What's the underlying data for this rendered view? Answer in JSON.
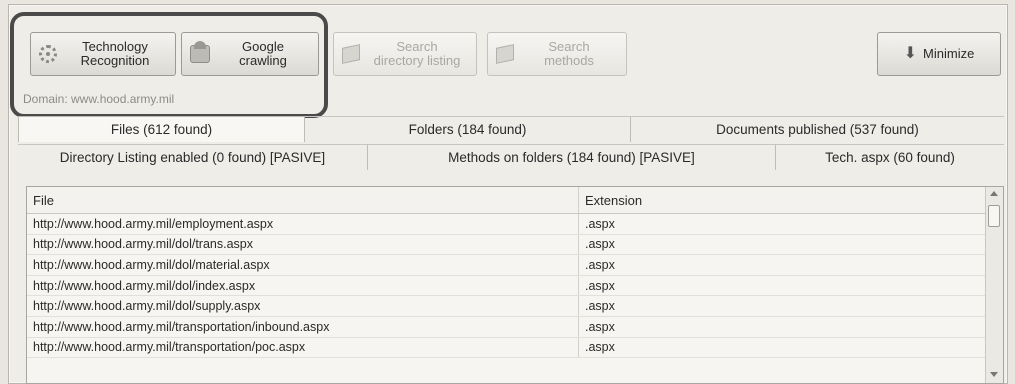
{
  "toolbar": {
    "technology_recognition": "Technology\nRecognition",
    "google_crawling": "Google\ncrawling",
    "search_directory_listing": "Search\ndirectory listing",
    "search_methods": "Search\nmethods",
    "minimize": "Minimize"
  },
  "domain_label": "Domain: www.hood.army.mil",
  "tabs_row1": [
    {
      "label": "Files (612 found)"
    },
    {
      "label": "Folders (184 found)"
    },
    {
      "label": "Documents published (537 found)"
    }
  ],
  "tabs_row2": [
    {
      "label": "Directory Listing enabled (0 found) [PASIVE]"
    },
    {
      "label": "Methods on folders (184 found) [PASIVE]"
    },
    {
      "label": "Tech. aspx (60 found)"
    }
  ],
  "grid": {
    "columns": [
      "File",
      "Extension"
    ],
    "rows": [
      {
        "file": "http://www.hood.army.mil/employment.aspx",
        "ext": ".aspx"
      },
      {
        "file": "http://www.hood.army.mil/dol/trans.aspx",
        "ext": ".aspx"
      },
      {
        "file": "http://www.hood.army.mil/dol/material.aspx",
        "ext": ".aspx"
      },
      {
        "file": "http://www.hood.army.mil/dol/index.aspx",
        "ext": ".aspx"
      },
      {
        "file": "http://www.hood.army.mil/dol/supply.aspx",
        "ext": ".aspx"
      },
      {
        "file": "http://www.hood.army.mil/transportation/inbound.aspx",
        "ext": ".aspx"
      },
      {
        "file": "http://www.hood.army.mil/transportation/poc.aspx",
        "ext": ".aspx"
      }
    ]
  }
}
